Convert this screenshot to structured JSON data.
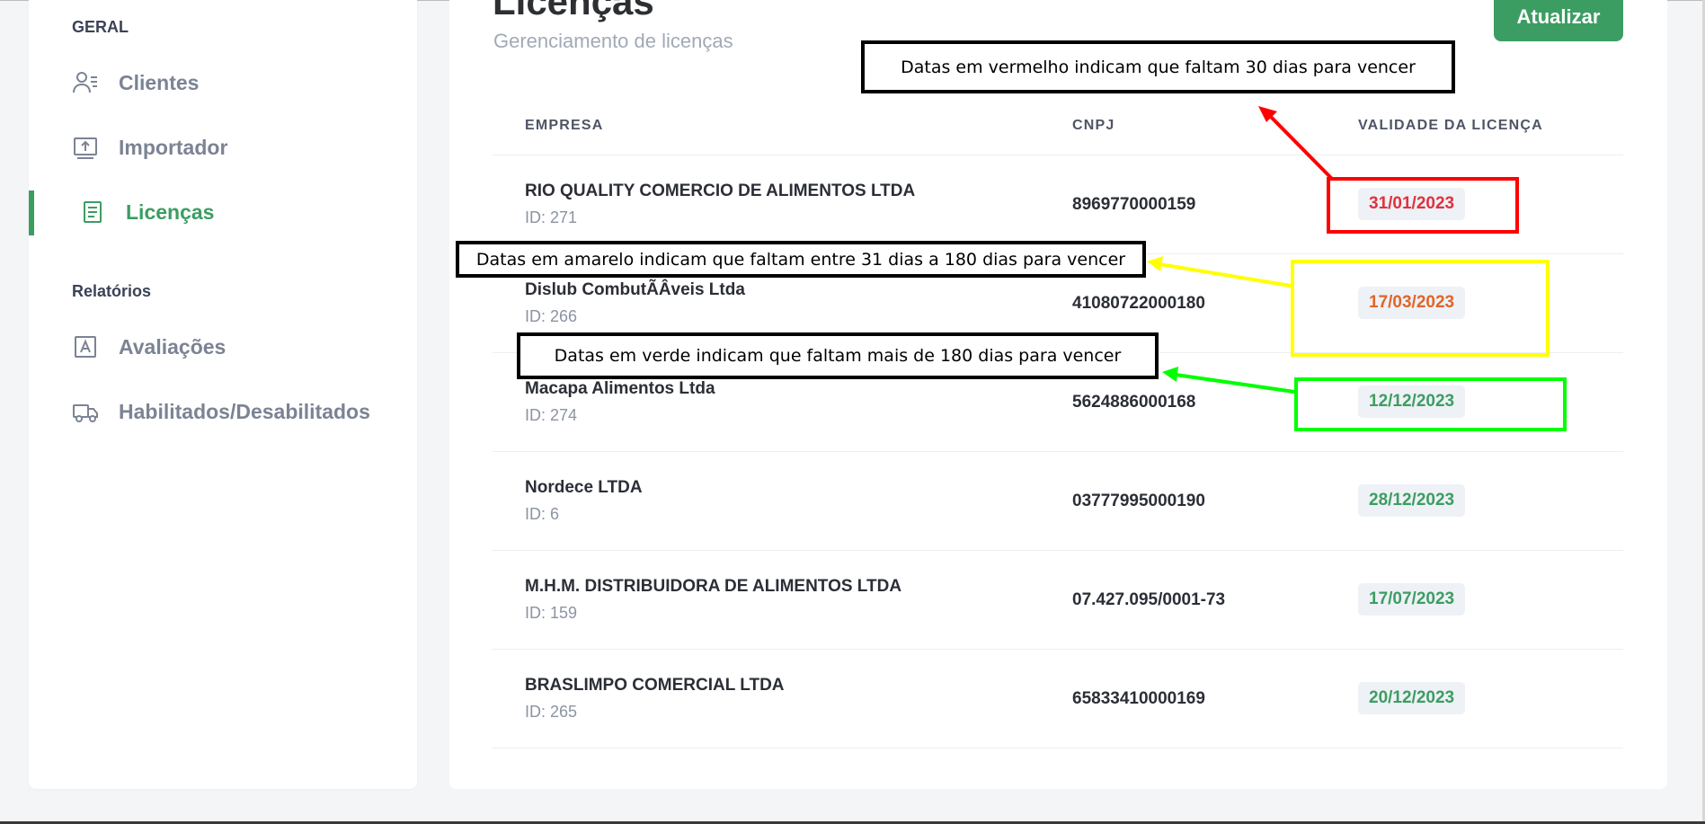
{
  "sidebar": {
    "section_geral": "GERAL",
    "section_relatorios": "Relatórios",
    "items": [
      {
        "label": "Clientes",
        "icon": "user-list-icon"
      },
      {
        "label": "Importador",
        "icon": "upload-icon"
      },
      {
        "label": "Licenças",
        "icon": "document-icon"
      },
      {
        "label": "Avaliações",
        "icon": "letter-a-icon"
      },
      {
        "label": "Habilitados/Desabilitados",
        "icon": "truck-icon"
      }
    ],
    "active_item": "Licenças"
  },
  "header": {
    "title": "Licenças",
    "subtitle": "Gerenciamento de licenças",
    "refresh_label": "Atualizar"
  },
  "table": {
    "columns": [
      "EMPRESA",
      "CNPJ",
      "VALIDADE DA LICENÇA"
    ],
    "rows": [
      {
        "name": "RIO QUALITY COMERCIO DE ALIMENTOS LTDA",
        "id": "ID: 271",
        "cnpj": "8969770000159",
        "validity": "31/01/2023",
        "status": "red"
      },
      {
        "name": "Dislub CombutÃ­Âveis Ltda",
        "id": "ID: 266",
        "cnpj": "41080722000180",
        "validity": "17/03/2023",
        "status": "yellow"
      },
      {
        "name": "Macapa Alimentos Ltda",
        "id": "ID: 274",
        "cnpj": "5624886000168",
        "validity": "12/12/2023",
        "status": "green"
      },
      {
        "name": "Nordece LTDA",
        "id": "ID: 6",
        "cnpj": "03777995000190",
        "validity": "28/12/2023",
        "status": "green"
      },
      {
        "name": "M.H.M. DISTRIBUIDORA DE ALIMENTOS LTDA",
        "id": "ID: 159",
        "cnpj": "07.427.095/0001-73",
        "validity": "17/07/2023",
        "status": "green"
      },
      {
        "name": "BRASLIMPO COMERCIAL LTDA",
        "id": "ID: 265",
        "cnpj": "65833410000169",
        "validity": "20/12/2023",
        "status": "green"
      }
    ]
  },
  "annotations": {
    "red_note": "Datas em vermelho indicam que faltam 30 dias para vencer",
    "yellow_note": "Datas em amarelo indicam que faltam entre 31 dias a 180 dias para vencer",
    "green_note": "Datas em  verde indicam que faltam mais de 180 dias para vencer"
  },
  "colors": {
    "accent": "#3c9d63",
    "date_red": "#e0313f",
    "date_yellow": "#e0652a",
    "date_green": "#3c9d63",
    "annot_red": "#ff0000",
    "annot_yellow": "#ffff00",
    "annot_green": "#00ff00"
  }
}
